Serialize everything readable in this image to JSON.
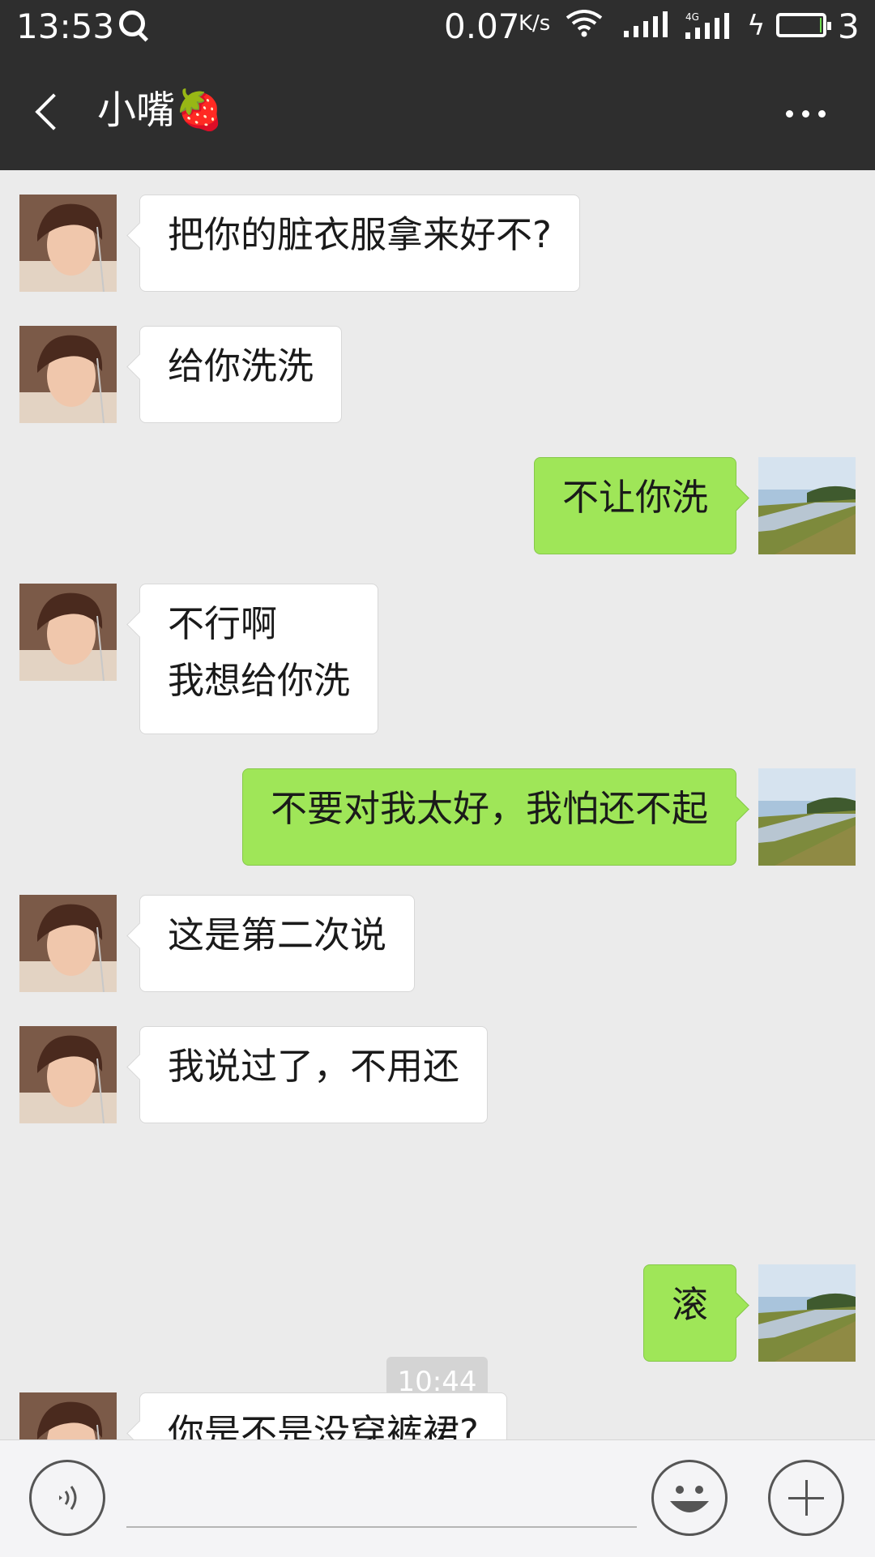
{
  "status_bar": {
    "time": "13:53",
    "speed": "0.07",
    "speed_unit": "K/s",
    "network": "4G",
    "battery_level": 3,
    "battery_text": "3"
  },
  "header": {
    "title": "小嘴🍓"
  },
  "messages": [
    {
      "side": "left",
      "text": "把你的脏衣服拿来好不?"
    },
    {
      "side": "left",
      "text": "给你洗洗"
    },
    {
      "side": "right",
      "text": "不让你洗"
    },
    {
      "side": "left",
      "text": "不行啊\n我想给你洗"
    },
    {
      "side": "right",
      "text": "不要对我太好，我怕还不起"
    },
    {
      "side": "left",
      "text": "这是第二次说"
    },
    {
      "side": "left",
      "text": " 我说过了，不用还"
    },
    {
      "side": "right",
      "text": "滚"
    },
    {
      "side": "left",
      "text": "你是不是没穿裤裙?"
    }
  ],
  "time_divider": "10:44",
  "input": {
    "placeholder": ""
  },
  "colors": {
    "header_bg": "#2e2e2e",
    "chat_bg": "#ebebeb",
    "sent_bubble": "#9fe658",
    "received_bubble": "#ffffff"
  }
}
